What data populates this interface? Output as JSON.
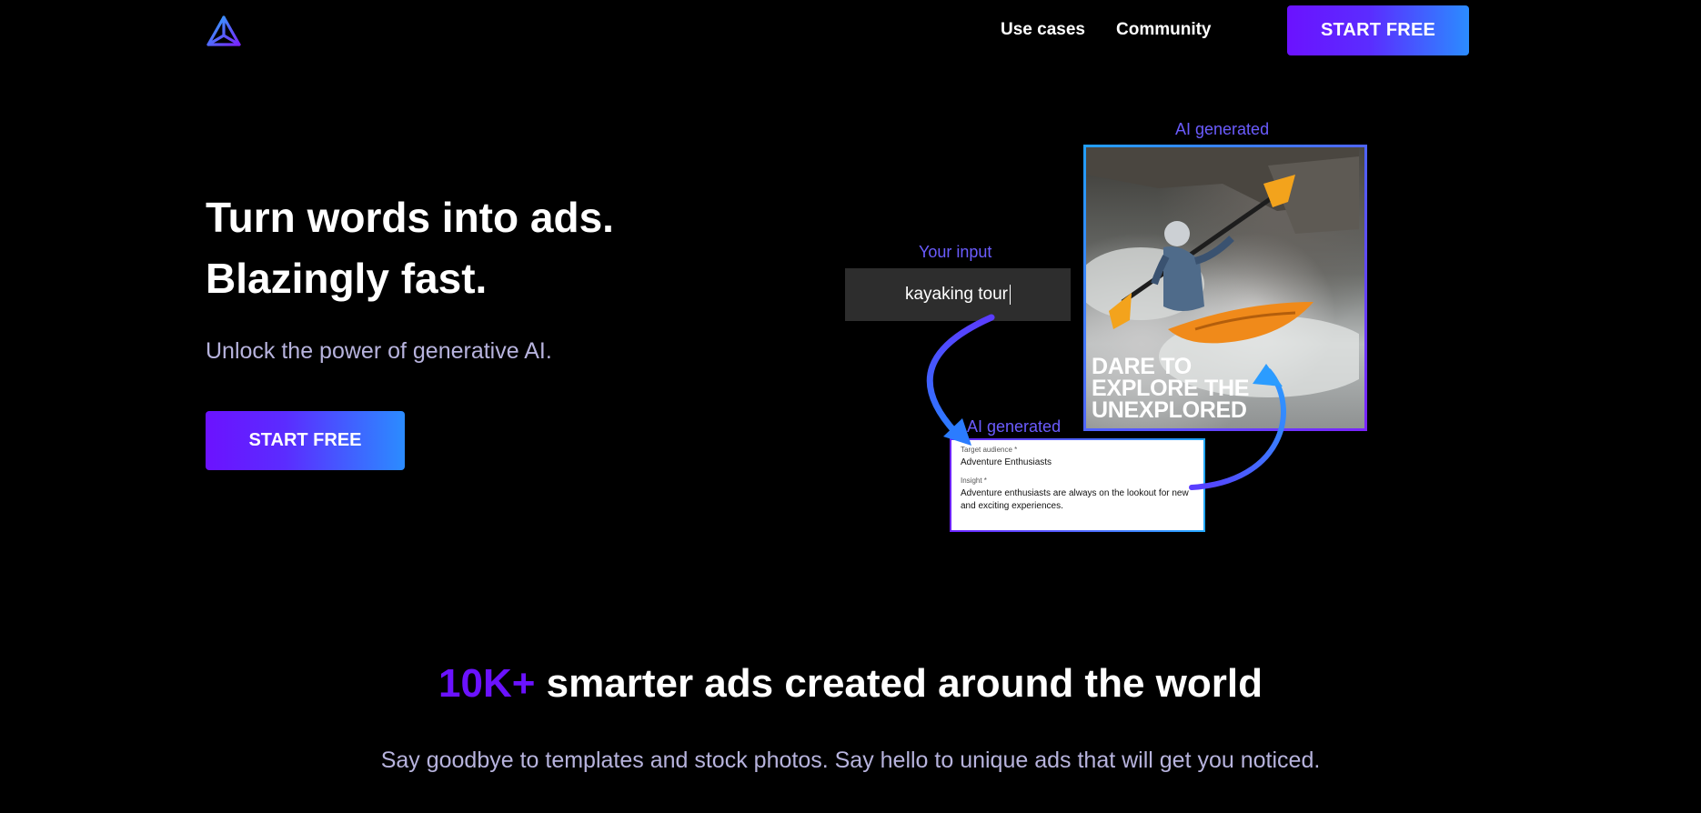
{
  "nav": {
    "links": [
      "Use cases",
      "Community"
    ],
    "cta_label": "START FREE"
  },
  "hero": {
    "title_lines": [
      "Turn words into ads.",
      "Blazingly fast."
    ],
    "subtitle": "Unlock the power of generative AI.",
    "cta_label": "START FREE"
  },
  "illustration": {
    "input_label": "Your input",
    "input_value": "kayaking tour",
    "ad_label": "AI generated",
    "ad_headline_lines": [
      "DARE TO",
      "EXPLORE THE",
      "UNEXPLORED"
    ],
    "form_label": "AI generated",
    "fields": [
      {
        "label": "Target audience *",
        "value": "Adventure Enthusiasts"
      },
      {
        "label": "Insight *",
        "value": "Adventure enthusiasts are always on the lookout for new and exciting experiences."
      }
    ]
  },
  "stats": {
    "number": "10K+",
    "headline": " smarter ads created around the world",
    "subtitle": "Say goodbye to templates and stock photos. Say hello to unique ads that will get you noticed."
  },
  "colors": {
    "accent_purple": "#6b12ff",
    "accent_blue": "#2b8cff",
    "label_purple": "#6b5cff",
    "muted_text": "#b7b3dd"
  },
  "icons": {
    "logo": "triangle-logo-icon",
    "arrows": "curved-arrow-icon"
  }
}
